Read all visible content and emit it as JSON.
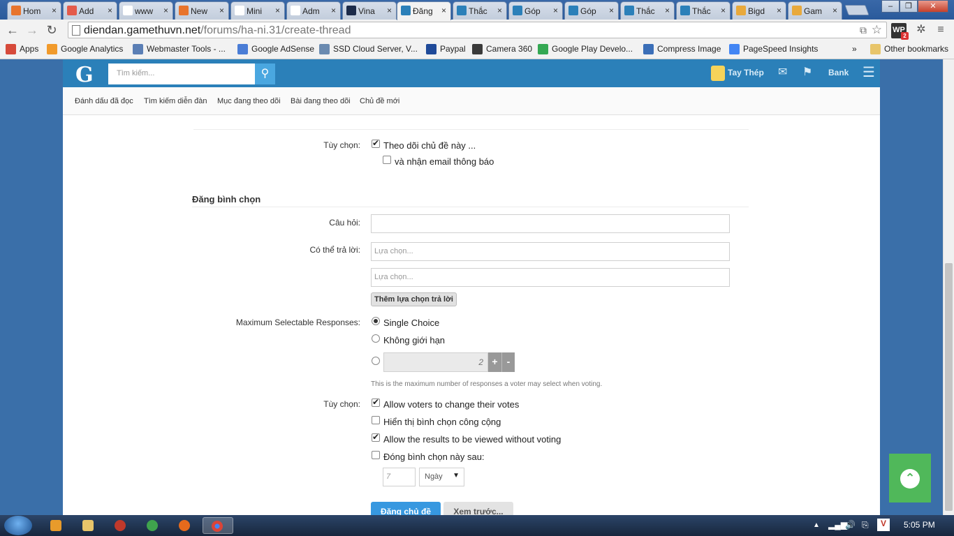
{
  "browser": {
    "tabs": [
      {
        "label": "Hom",
        "fav_color": "#e8742c"
      },
      {
        "label": "Add",
        "fav_color": "#e45b4b"
      },
      {
        "label": "www",
        "fav_color": "#ffffff"
      },
      {
        "label": "New",
        "fav_color": "#e8742c"
      },
      {
        "label": "Mini",
        "fav_color": "#ffffff"
      },
      {
        "label": "Adm",
        "fav_color": "#ffffff"
      },
      {
        "label": "Vina",
        "fav_color": "#1c2b4a"
      },
      {
        "label": "Đăng",
        "fav_color": "#2b80b9",
        "active": true
      },
      {
        "label": "Thắc",
        "fav_color": "#2b80b9"
      },
      {
        "label": "Góp",
        "fav_color": "#2b80b9"
      },
      {
        "label": "Góp",
        "fav_color": "#2b80b9"
      },
      {
        "label": "Thắc",
        "fav_color": "#2b80b9"
      },
      {
        "label": "Thắc",
        "fav_color": "#2b80b9"
      },
      {
        "label": "Bigd",
        "fav_color": "#e8a93c"
      },
      {
        "label": "Gam",
        "fav_color": "#e8a93c"
      }
    ],
    "url_host": "diendan.gamethuvn.net",
    "url_path": "/forums/ha-ni.31/create-thread",
    "bookmarks": [
      {
        "label": "Apps",
        "icon": "apps-grid-icon"
      },
      {
        "label": "Google Analytics",
        "icon": "analytics-icon"
      },
      {
        "label": "Webmaster Tools - ...",
        "icon": "webmaster-icon"
      },
      {
        "label": "Google AdSense",
        "icon": "adsense-icon"
      },
      {
        "label": "SSD Cloud Server, V...",
        "icon": "cloud-icon"
      },
      {
        "label": "Paypal",
        "icon": "paypal-icon"
      },
      {
        "label": "Camera 360",
        "icon": "camera-icon"
      },
      {
        "label": "Google Play Develo...",
        "icon": "play-icon"
      },
      {
        "label": "Compress Image",
        "icon": "image-icon"
      },
      {
        "label": "PageSpeed Insights",
        "icon": "pagespeed-icon"
      }
    ],
    "bookmarks_overflow": "»",
    "other_bookmarks": "Other bookmarks",
    "ext_badge": "2",
    "ext_wp": "WP"
  },
  "site": {
    "logo": "G",
    "search_placeholder": "Tìm kiếm...",
    "user_name": "Tay Thép",
    "bank": "Bank",
    "subnav": [
      "Đánh dấu đã đọc",
      "Tìm kiếm diễn đàn",
      "Mục đang theo dõi",
      "Bài đang theo dõi",
      "Chủ đề mới"
    ]
  },
  "form": {
    "options_label": "Tùy chọn:",
    "watch_thread": {
      "label": "Theo dõi chủ đề này ...",
      "checked": true
    },
    "email_notify": {
      "label": "và nhận email thông báo",
      "checked": false
    },
    "poll_title": "Đăng bình chọn",
    "question_label": "Câu hỏi:",
    "question_value": "",
    "responses_label": "Có thể trả lời:",
    "response_placeholders": [
      "Lựa chọn...",
      "Lựa chọn..."
    ],
    "add_response": "Thêm lựa chọn trả lời",
    "max_label": "Maximum Selectable Responses:",
    "max_options": [
      {
        "label": "Single Choice",
        "selected": true
      },
      {
        "label": "Không giới hạn",
        "selected": false
      }
    ],
    "max_number": "2",
    "plus": "+",
    "minus": "-",
    "max_hint": "This is the maximum number of responses a voter may select when voting.",
    "poll_options_label": "Tùy chọn:",
    "poll_options": [
      {
        "label": "Allow voters to change their votes",
        "checked": true
      },
      {
        "label": "Hiển thị bình chọn công cộng",
        "checked": false
      },
      {
        "label": "Allow the results to be viewed without voting",
        "checked": true
      },
      {
        "label": "Đóng bình chọn này sau:",
        "checked": false
      }
    ],
    "close_after_value": "7",
    "close_after_unit": "Ngày",
    "submit": "Đăng chủ đề",
    "preview": "Xem trước..."
  },
  "taskbar": {
    "time": "5:05 PM"
  }
}
